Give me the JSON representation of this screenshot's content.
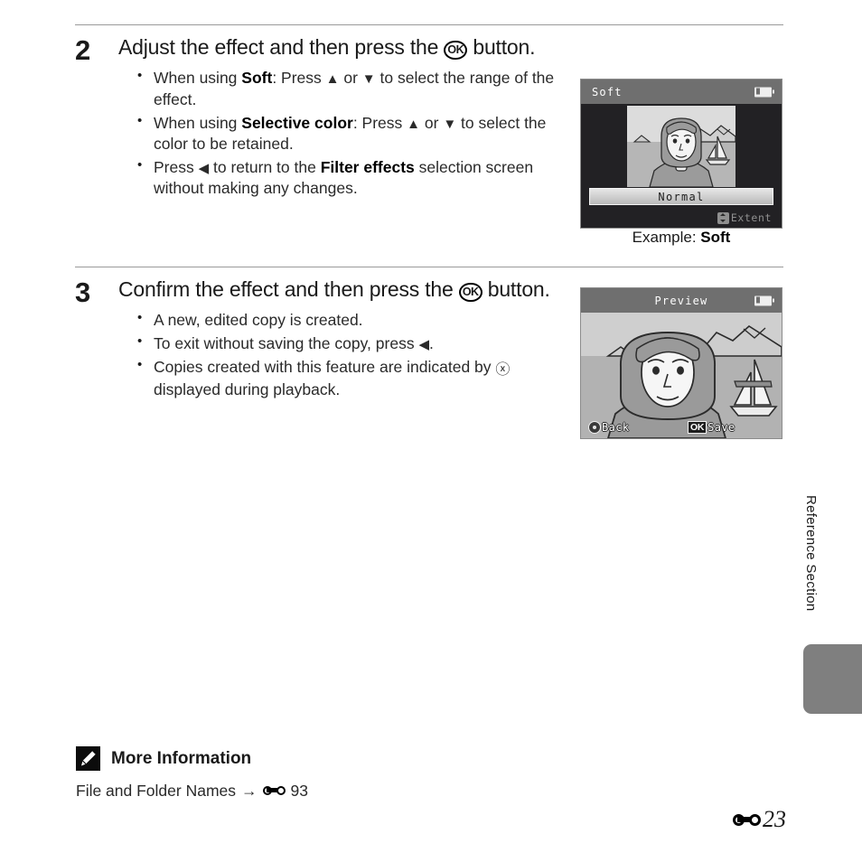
{
  "page": {
    "number": "23",
    "number_prefix_icon": "e-symbol-icon",
    "side_tab_label": "Reference Section"
  },
  "steps": [
    {
      "number": "2",
      "heading_before_ok": "Adjust the effect and then press the ",
      "ok_glyph": "OK",
      "heading_after_ok": " button.",
      "bullets": [
        {
          "parts": [
            {
              "t": "When using ",
              "b": false
            },
            {
              "t": "Soft",
              "b": true
            },
            {
              "t": ": Press ",
              "b": false
            },
            {
              "t": "▲",
              "b": false
            },
            {
              "t": " or ",
              "b": false
            },
            {
              "t": "▼",
              "b": false
            },
            {
              "t": " to select the range of the effect.",
              "b": false
            }
          ]
        },
        {
          "parts": [
            {
              "t": "When using ",
              "b": false
            },
            {
              "t": "Selective color",
              "b": true
            },
            {
              "t": ": Press ",
              "b": false
            },
            {
              "t": "▲",
              "b": false
            },
            {
              "t": " or ",
              "b": false
            },
            {
              "t": "▼",
              "b": false
            },
            {
              "t": " to select the color to be retained.",
              "b": false
            }
          ]
        },
        {
          "parts": [
            {
              "t": "Press ",
              "b": false
            },
            {
              "t": "◀",
              "b": false
            },
            {
              "t": " to return to the ",
              "b": false
            },
            {
              "t": "Filter effects",
              "b": true
            },
            {
              "t": " selection screen without making any changes.",
              "b": false
            }
          ]
        }
      ]
    },
    {
      "number": "3",
      "heading_before_ok": "Confirm the effect and then press the ",
      "ok_glyph": "OK",
      "heading_after_ok": " button.",
      "bullets": [
        {
          "parts": [
            {
              "t": "A new, edited copy is created.",
              "b": false
            }
          ]
        },
        {
          "parts": [
            {
              "t": "To exit without saving the copy, press ",
              "b": false
            },
            {
              "t": "◀",
              "b": false
            },
            {
              "t": ".",
              "b": false
            }
          ]
        },
        {
          "parts": [
            {
              "t": "Copies created with this feature are indicated by ",
              "b": false
            },
            {
              "t": "ⓧ",
              "b": false
            },
            {
              "t": " displayed during playback.",
              "b": false
            }
          ]
        }
      ]
    }
  ],
  "screens": {
    "soft": {
      "title": "Soft",
      "battery_icon": "battery-icon",
      "option_label": "Normal",
      "hint_label": "Extent",
      "hint_icon": "up-down-arrow-icon",
      "caption_plain": "Example: ",
      "caption_bold": "Soft"
    },
    "preview": {
      "title": "Preview",
      "battery_icon": "battery-icon",
      "back_label": "Back",
      "back_icon": "multi-selector-icon",
      "save_label": "Save",
      "save_icon": "ok-button-icon"
    }
  },
  "more_information": {
    "icon": "pencil-note-icon",
    "title": "More Information",
    "link_text": "File and Folder Names",
    "arrow": "→",
    "ref_icon": "e-symbol-icon",
    "ref_page": "93"
  },
  "colors": {
    "rule": "#9a9a9a",
    "screen_header": "#6f6f6f",
    "screen_body_dark": "#222124",
    "screen_body_light": "#c9c9c9",
    "side_tab": "#7f7f7f"
  }
}
